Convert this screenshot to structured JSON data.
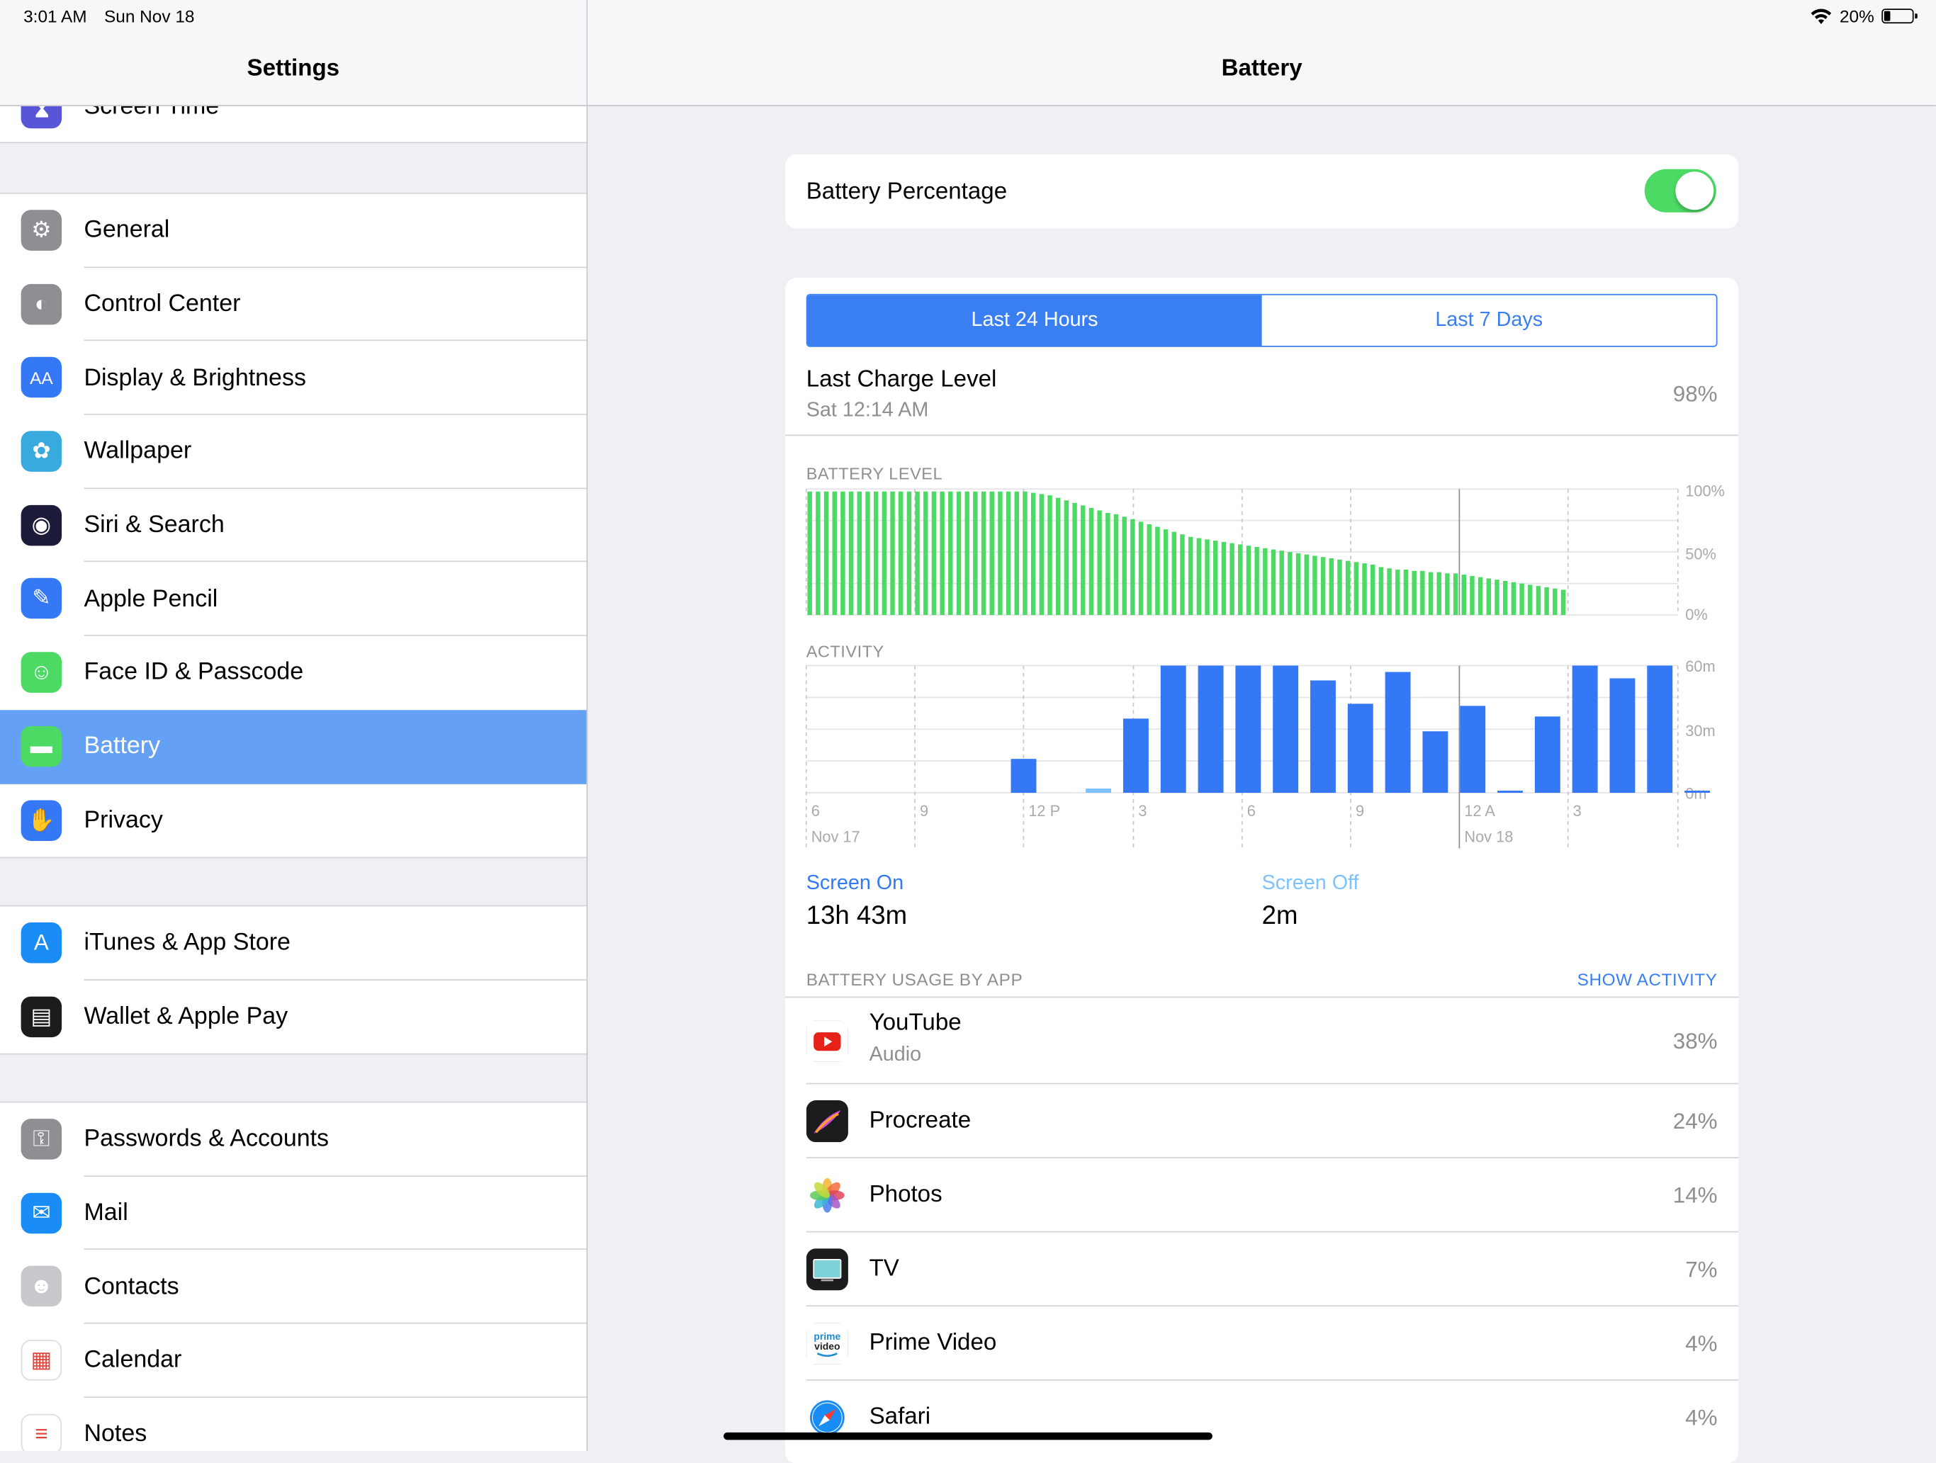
{
  "status_bar": {
    "time": "3:01 AM",
    "date": "Sun Nov 18",
    "battery_text": "20%",
    "battery_level": 0.2
  },
  "sidebar": {
    "title": "Settings",
    "partial_item": "Screen Time",
    "groups": [
      [
        {
          "label": "General",
          "icon": "gear-icon",
          "color": "#8e8e93"
        },
        {
          "label": "Control Center",
          "icon": "toggles-icon",
          "color": "#8e8e93"
        },
        {
          "label": "Display & Brightness",
          "icon": "text-size-icon",
          "color": "#3478f6"
        },
        {
          "label": "Wallpaper",
          "icon": "flower-icon",
          "color": "#38aade"
        },
        {
          "label": "Siri & Search",
          "icon": "siri-icon",
          "color": "#1c1c3a"
        },
        {
          "label": "Apple Pencil",
          "icon": "pencil-icon",
          "color": "#3478f6"
        },
        {
          "label": "Face ID & Passcode",
          "icon": "face-id-icon",
          "color": "#4cd964"
        },
        {
          "label": "Battery",
          "icon": "battery-icon",
          "color": "#4cd964",
          "selected": true
        },
        {
          "label": "Privacy",
          "icon": "hand-icon",
          "color": "#3478f6"
        }
      ],
      [
        {
          "label": "iTunes & App Store",
          "icon": "app-store-icon",
          "color": "#1a8cf5"
        },
        {
          "label": "Wallet & Apple Pay",
          "icon": "wallet-icon",
          "color": "#1c1c1e"
        }
      ],
      [
        {
          "label": "Passwords & Accounts",
          "icon": "key-icon",
          "color": "#8e8e93"
        },
        {
          "label": "Mail",
          "icon": "mail-icon",
          "color": "#1a8cf5"
        },
        {
          "label": "Contacts",
          "icon": "contacts-icon",
          "color": "#c7c7cc"
        },
        {
          "label": "Calendar",
          "icon": "calendar-icon",
          "color": "#ffffff"
        },
        {
          "label": "Notes",
          "icon": "notes-icon",
          "color": "#ffffff"
        }
      ]
    ]
  },
  "main": {
    "title": "Battery",
    "battery_percentage_label": "Battery Percentage",
    "battery_percentage_on": true,
    "tabs": [
      "Last 24 Hours",
      "Last 7 Days"
    ],
    "active_tab": 0,
    "last_charge_label": "Last Charge Level",
    "last_charge_date": "Sat 12:14 AM",
    "last_charge_value": "98%",
    "screen_on_label": "Screen On",
    "screen_on_value": "13h 43m",
    "screen_off_label": "Screen Off",
    "screen_off_value": "2m",
    "usage_caption": "BATTERY USAGE BY APP",
    "show_activity": "SHOW ACTIVITY",
    "apps": [
      {
        "name": "YouTube",
        "sub": "Audio",
        "pct": "38%",
        "icon": "youtube-icon"
      },
      {
        "name": "Procreate",
        "sub": "",
        "pct": "24%",
        "icon": "procreate-icon"
      },
      {
        "name": "Photos",
        "sub": "",
        "pct": "14%",
        "icon": "photos-icon"
      },
      {
        "name": "TV",
        "sub": "",
        "pct": "7%",
        "icon": "tv-icon"
      },
      {
        "name": "Prime Video",
        "sub": "",
        "pct": "4%",
        "icon": "prime-video-icon",
        "icon_text_top": "prime",
        "icon_text_bottom": "video"
      },
      {
        "name": "Safari",
        "sub": "",
        "pct": "4%",
        "icon": "safari-icon"
      }
    ]
  },
  "chart_data": [
    {
      "type": "bar",
      "title": "BATTERY LEVEL",
      "y_tick_labels": [
        "100%",
        "50%",
        "0%"
      ],
      "ylim": [
        0,
        100
      ],
      "color": "#4cd964",
      "values": [
        98,
        98,
        98,
        98,
        98,
        98,
        98,
        98,
        98,
        98,
        98,
        98,
        98,
        98,
        98,
        98,
        98,
        98,
        98,
        98,
        98,
        98,
        98,
        98,
        98,
        98,
        98,
        97,
        96,
        95,
        93,
        91,
        89,
        87,
        85,
        83,
        81,
        80,
        78,
        76,
        74,
        72,
        70,
        68,
        66,
        64,
        62,
        61,
        60,
        59,
        58,
        57,
        56,
        55,
        54,
        53,
        52,
        51,
        50,
        49,
        48,
        47,
        46,
        45,
        44,
        43,
        42,
        41,
        40,
        38,
        37,
        36,
        36,
        35,
        35,
        34,
        34,
        33,
        33,
        32,
        31,
        30,
        29,
        28,
        27,
        26,
        25,
        24,
        23,
        22,
        21,
        20
      ]
    },
    {
      "type": "bar",
      "title": "ACTIVITY",
      "y_tick_labels": [
        "60m",
        "30m",
        "0m"
      ],
      "ylim": [
        0,
        60
      ],
      "x_tick_labels": [
        {
          "label": "6",
          "sub": "Nov 17"
        },
        {
          "label": "9",
          "sub": ""
        },
        {
          "label": "12 P",
          "sub": ""
        },
        {
          "label": "3",
          "sub": ""
        },
        {
          "label": "6",
          "sub": ""
        },
        {
          "label": "9",
          "sub": ""
        },
        {
          "label": "12 A",
          "sub": "Nov 18"
        },
        {
          "label": "3",
          "sub": ""
        }
      ],
      "color": "#3478f6",
      "screen_off_color": "#7cc2ff",
      "values": [
        0,
        0,
        0,
        16,
        0,
        2,
        35,
        60,
        60,
        60,
        60,
        53,
        42,
        57,
        29,
        41,
        1,
        36,
        60,
        54,
        60,
        1
      ],
      "off_values": [
        0,
        0,
        0,
        0,
        0,
        2,
        0,
        0,
        0,
        0,
        0,
        0,
        0,
        0,
        0,
        0,
        0,
        0,
        0,
        0,
        0,
        0
      ]
    }
  ]
}
